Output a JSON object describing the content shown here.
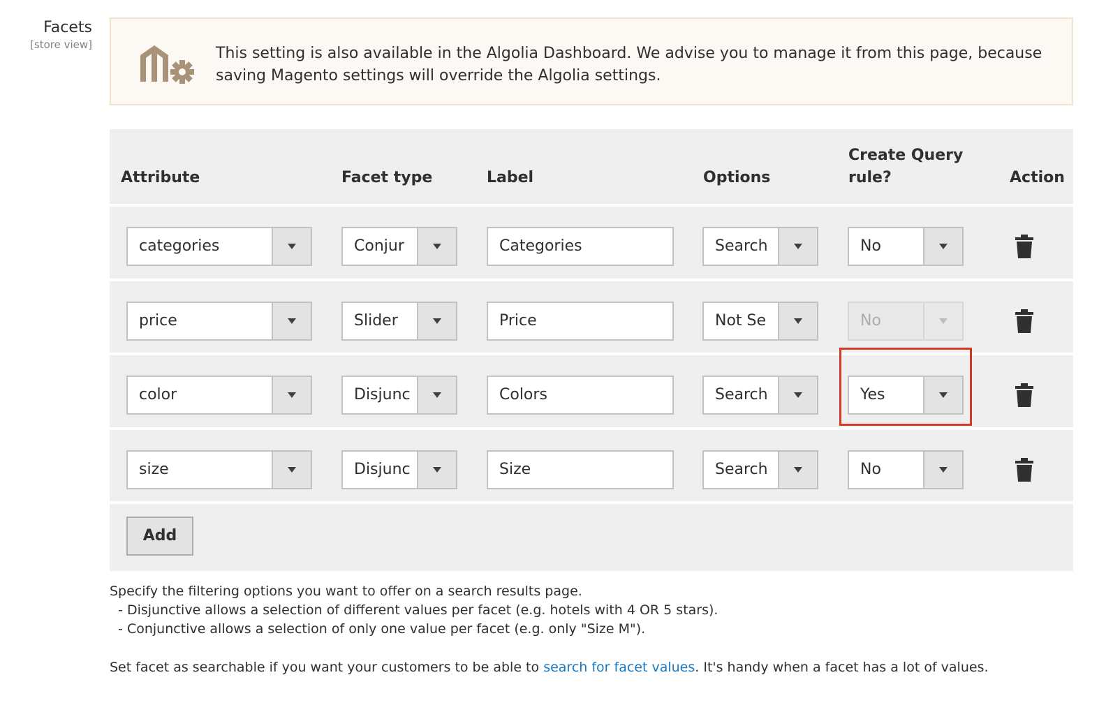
{
  "field": {
    "label": "Facets",
    "scope": "[store view]"
  },
  "notice": {
    "line1": "This setting is also available in the Algolia Dashboard. We advise you to manage it from this page, because",
    "line2": "saving Magento settings will override the Algolia settings.",
    "icon": "magento-gear-icon"
  },
  "table": {
    "headers": {
      "attribute": "Attribute",
      "facet_type": "Facet type",
      "label": "Label",
      "options": "Options",
      "query_rule_line1": "Create Query",
      "query_rule_line2": "rule?",
      "action": "Action"
    },
    "rows": [
      {
        "attribute": "categories",
        "facet_type": "Conjur",
        "label": "Categories",
        "options": "Search",
        "query_rule": "No"
      },
      {
        "attribute": "price",
        "facet_type": "Slider",
        "label": "Price",
        "options": "Not Se",
        "query_rule": "No"
      },
      {
        "attribute": "color",
        "facet_type": "Disjunс",
        "label": "Colors",
        "options": "Search",
        "query_rule": "Yes"
      },
      {
        "attribute": "size",
        "facet_type": "Disjunс",
        "label": "Size",
        "options": "Search",
        "query_rule": "No"
      }
    ],
    "add_label": "Add"
  },
  "comment": {
    "line1": "Specify the filtering options you want to offer on a search results page.",
    "line2": "  - Disjunctive allows a selection of different values per facet (e.g. hotels with 4 OR 5 stars).",
    "line3": "  - Conjunctive allows a selection of only one value per facet (e.g. only \"Size M\").",
    "line4_before": "Set facet as searchable if you want your customers to be able to ",
    "line4_link": "search for facet values",
    "line4_after": ". It's handy when a facet has a lot of values."
  },
  "colors": {
    "highlight": "#d13b26",
    "link": "#1979c3",
    "notice_bg": "#fcf8f3"
  }
}
